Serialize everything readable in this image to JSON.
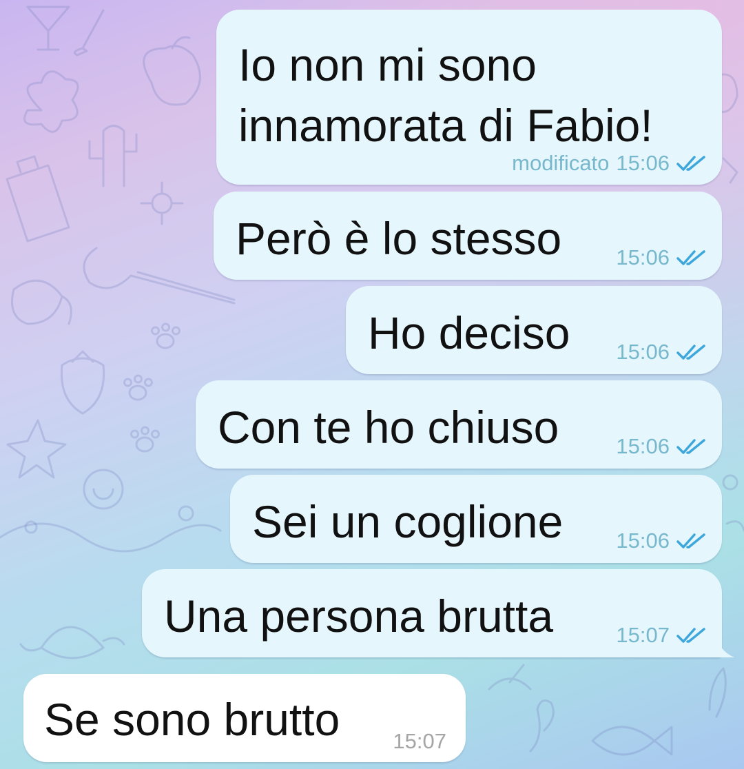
{
  "colors": {
    "outgoing_bubble": "#e6f6fd",
    "incoming_bubble": "#ffffff",
    "read_ticks": "#3da7dc",
    "outgoing_meta": "#78b8cd",
    "incoming_meta": "#a5a5a5"
  },
  "messages": [
    {
      "direction": "outgoing",
      "text_line1": "Io non mi sono",
      "text_line2": "innamorata di Fabio!",
      "edited_label": "modificato",
      "time": "15:06",
      "status": "read-double-check-icon"
    },
    {
      "direction": "outgoing",
      "text": "Però è lo stesso",
      "time": "15:06",
      "status": "read-double-check-icon"
    },
    {
      "direction": "outgoing",
      "text": "Ho deciso",
      "time": "15:06",
      "status": "read-double-check-icon"
    },
    {
      "direction": "outgoing",
      "text": "Con te ho chiuso",
      "time": "15:06",
      "status": "read-double-check-icon"
    },
    {
      "direction": "outgoing",
      "text": "Sei un coglione",
      "time": "15:06",
      "status": "read-double-check-icon"
    },
    {
      "direction": "outgoing",
      "text": "Una persona brutta",
      "time": "15:07",
      "status": "read-double-check-icon"
    },
    {
      "direction": "incoming",
      "text": "Se sono brutto",
      "time": "15:07"
    }
  ]
}
